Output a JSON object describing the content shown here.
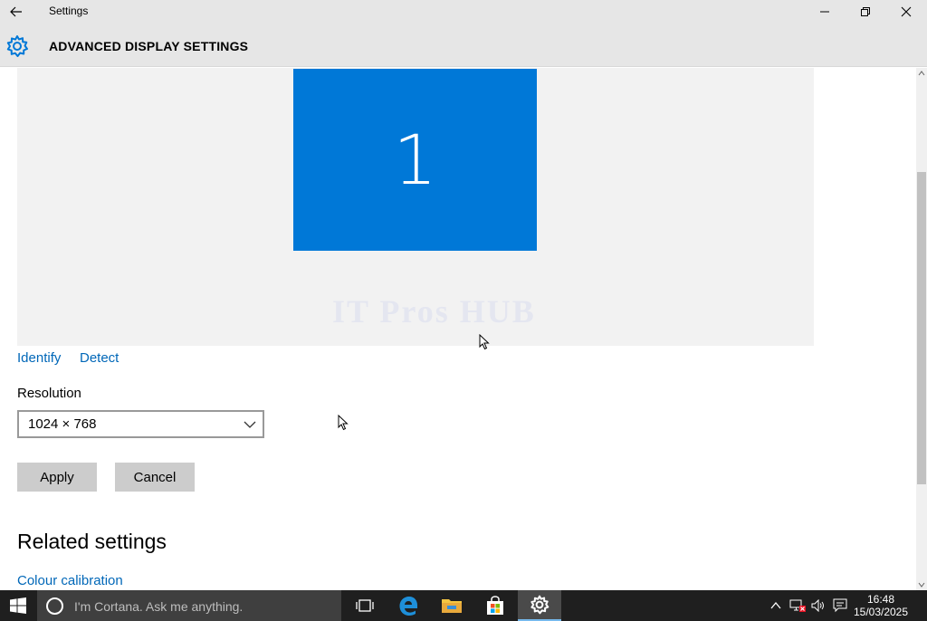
{
  "window": {
    "title": "Settings"
  },
  "header": {
    "title": "ADVANCED DISPLAY SETTINGS"
  },
  "display": {
    "monitor_number": "1",
    "watermark": "IT Pros HUB"
  },
  "links": {
    "identify": "Identify",
    "detect": "Detect"
  },
  "resolution": {
    "label": "Resolution",
    "value": "1024 × 768"
  },
  "buttons": {
    "apply": "Apply",
    "cancel": "Cancel"
  },
  "related": {
    "heading": "Related settings",
    "colour_calibration": "Colour calibration"
  },
  "taskbar": {
    "search_placeholder": "I'm Cortana. Ask me anything.",
    "time": "16:48",
    "date": "15/03/2025"
  },
  "colors": {
    "accent": "#0078d7",
    "link": "#0067b8",
    "titlebar": "#e6e6e6",
    "taskbar": "#1f1f1f"
  }
}
